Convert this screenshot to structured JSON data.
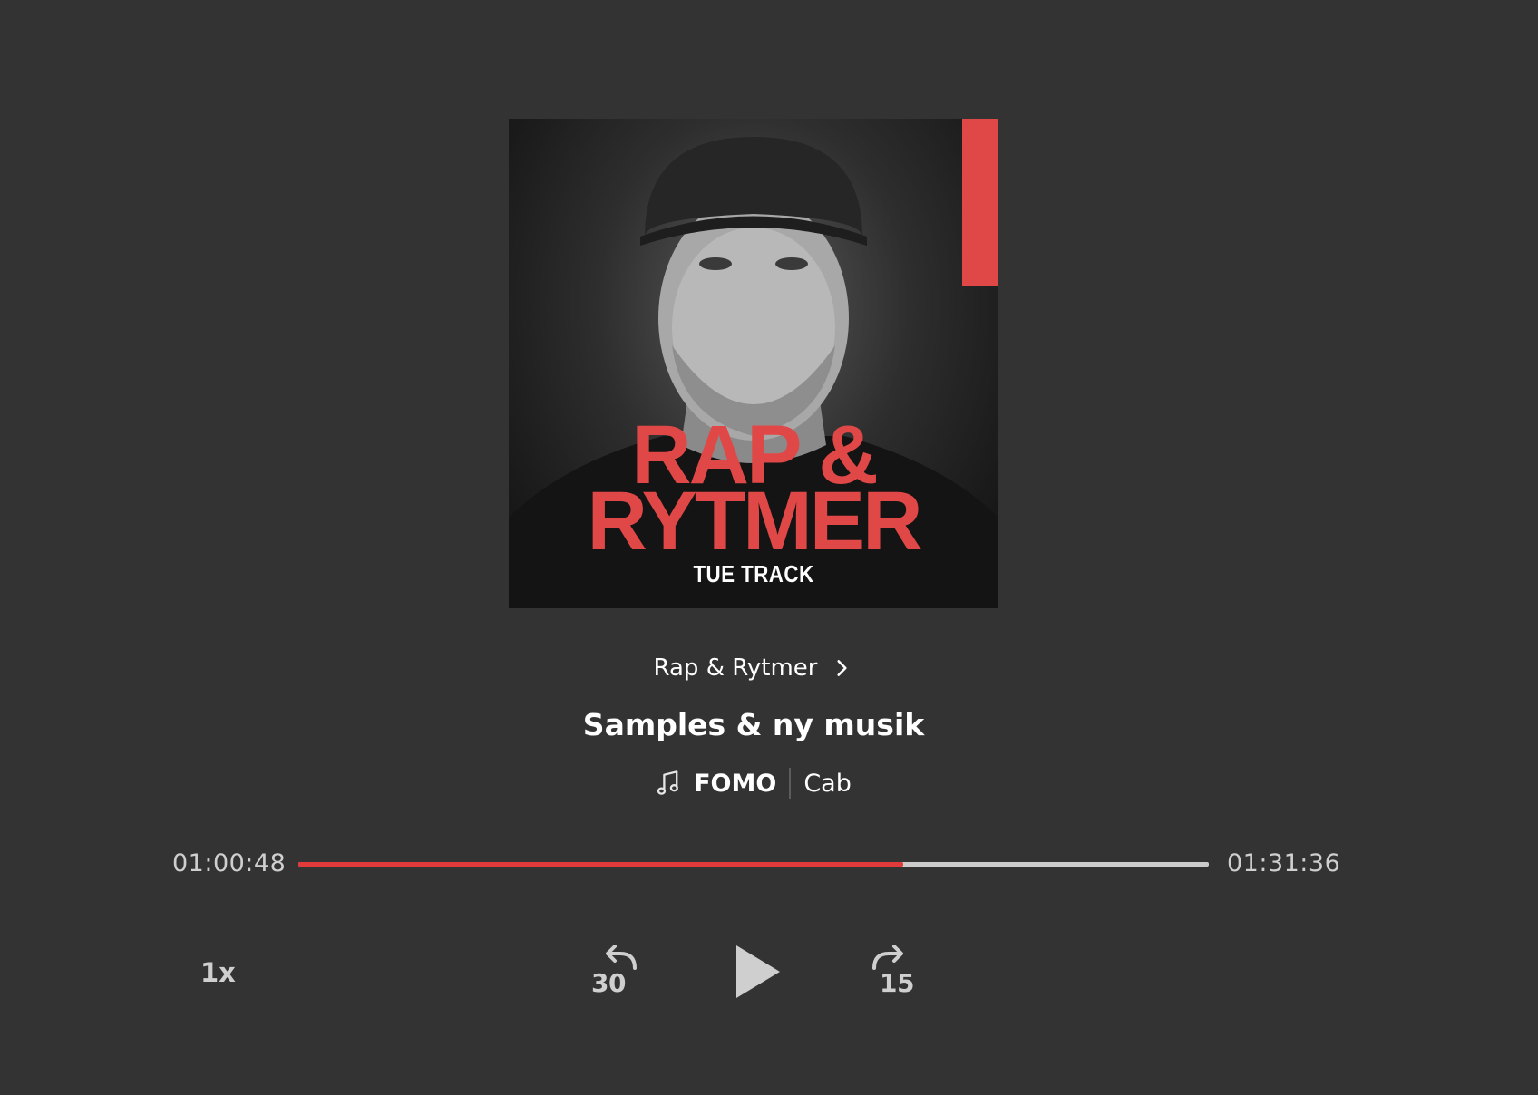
{
  "cover": {
    "brand_line1": "RAP &",
    "brand_line2": "RYTMER",
    "host": "TUE TRACK",
    "accent_color": "#e04848"
  },
  "program": {
    "name": "Rap & Rytmer",
    "chevron_icon": "chevron-right-icon"
  },
  "episode": {
    "title": "Samples & ny musik"
  },
  "now_playing": {
    "icon": "music-note-icon",
    "track": "FOMO",
    "artist": "Cab"
  },
  "progress": {
    "elapsed": "01:00:48",
    "total": "01:31:36",
    "fraction": 0.664,
    "fill_color": "#e03a3a"
  },
  "controls": {
    "speed": "1x",
    "skip_back": "30",
    "skip_forward": "15",
    "play_icon": "play-icon"
  }
}
